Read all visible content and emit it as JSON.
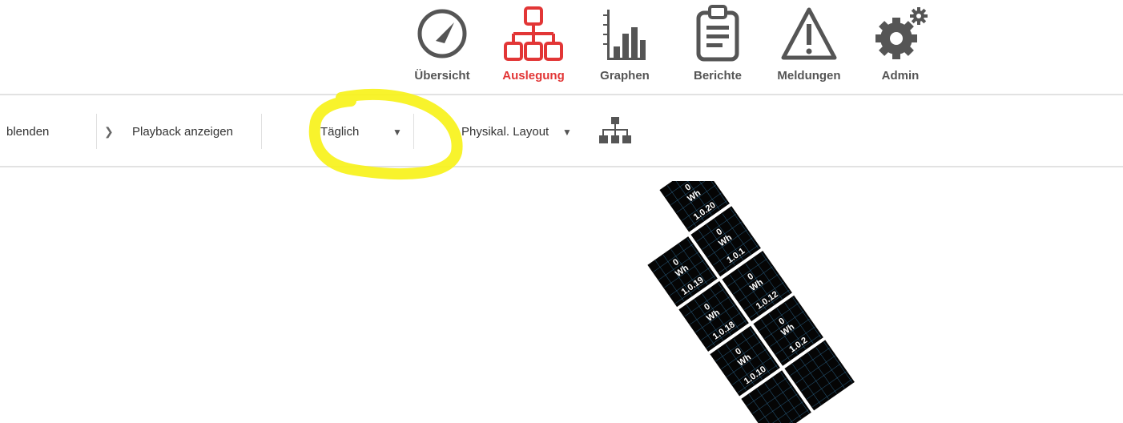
{
  "nav": {
    "items": [
      {
        "label": "Übersicht",
        "icon": "speedometer-icon",
        "active": false
      },
      {
        "label": "Auslegung",
        "icon": "sitemap-icon",
        "active": true
      },
      {
        "label": "Graphen",
        "icon": "bar-chart-icon",
        "active": false
      },
      {
        "label": "Berichte",
        "icon": "clipboard-icon",
        "active": false
      },
      {
        "label": "Meldungen",
        "icon": "warning-icon",
        "active": false
      },
      {
        "label": "Admin",
        "icon": "gears-icon",
        "active": false
      }
    ],
    "colors": {
      "active": "#e23636",
      "inactive": "#555555"
    }
  },
  "toolbar": {
    "blenden_label": "blenden",
    "playback_label": "Playback anzeigen",
    "period_select": {
      "value": "Täglich"
    },
    "layout_select": {
      "value": "Physikal. Layout"
    },
    "layout_icon": "sitemap-icon"
  },
  "panels": {
    "unit": "Wh",
    "items": [
      {
        "id": "1.0.20",
        "value": "0"
      },
      {
        "id": "1.0.19",
        "value": "0"
      },
      {
        "id": "1.0.1",
        "value": "0"
      },
      {
        "id": "1.0.18",
        "value": "0"
      },
      {
        "id": "1.0.12",
        "value": "0"
      },
      {
        "id": "1.0.10",
        "value": "0"
      },
      {
        "id": "1.0.2",
        "value": "0"
      }
    ],
    "colors": {
      "panel_bg": "#050505",
      "grid": "#2e6f9a",
      "text": "#ffffff"
    }
  },
  "highlight_color": "#f7f21a"
}
